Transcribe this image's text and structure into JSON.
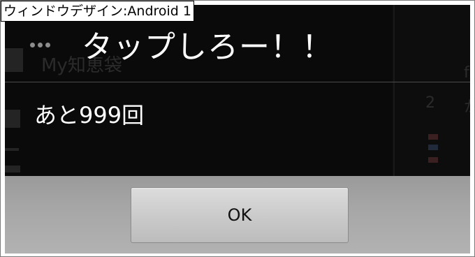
{
  "window": {
    "caption": "ウィンドウデザイン:Android 1"
  },
  "background_app": {
    "faint_title": "My知恵袋",
    "side_glyph": "f",
    "side_number": "2",
    "side_glyph_2": "か"
  },
  "dialog": {
    "title": "タップしろー！！",
    "message": "あと999回",
    "ok_label": "OK"
  },
  "colors": {
    "dialog_background": "#0a0a0a",
    "title_text": "#ffffff",
    "button_bar": "#a6a6a6",
    "button_face": "#c8c8c8"
  }
}
